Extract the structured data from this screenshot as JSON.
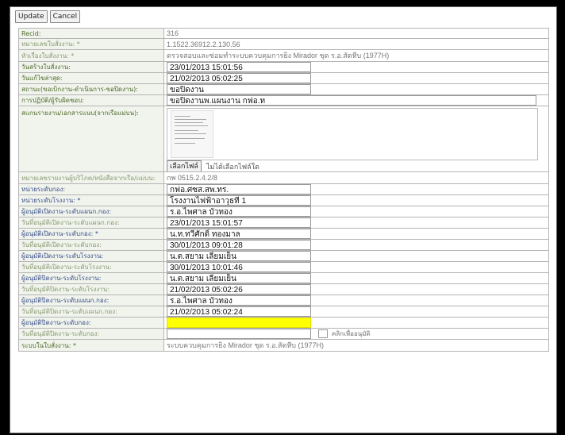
{
  "toolbar": {
    "update_label": "Update",
    "cancel_label": "Cancel"
  },
  "rows": {
    "recid": {
      "label": "Recid:",
      "value": "316"
    },
    "doc_no": {
      "label": "หมายเลขใบสั่งงาน: *",
      "value": "1.1522.36912.2.130.56"
    },
    "subject": {
      "label": "หัวเรื่องใบสั่งงาน: *",
      "value": "ตรวจสอบและซ่อมทำระบบควบคุมการยิง Mirador ชุด ร.อ.สัตหีบ (1977H)"
    },
    "created": {
      "label": "วันสร้างใบสั่งงาน:",
      "value": "23/01/2013 15:01:56"
    },
    "updated": {
      "label": "วันแก้ไขล่าสุด:",
      "value": "21/02/2013 05:02:25"
    },
    "status": {
      "label": "สถานะ(ขอเบิกงาน-ดำเนินการ-ขอปิดงาน):",
      "value": "ขอปิดงาน"
    },
    "result": {
      "label": "การปฏิบัติ/ผู้รับผิดชอบ:",
      "value": "ขอปิดงานพ.แผนงาน กฟอ.ท"
    },
    "attachment": {
      "label": "สแกนรายงาน/เอกสารแนบ(จากเรือแม่บน):",
      "button": "เลือกไฟล์",
      "no_file": "ไม่ได้เลือกไฟล์ใด"
    },
    "ref_no": {
      "label": "หมายเลขรายงานผู้บริโภค/หนังสือจากเรือ/แม่บน:",
      "value": "กพ 0515.2.4.2/8"
    },
    "unit": {
      "label": "หน่วยระดับกอง:",
      "value": "กฟอ.ศซส.สพ.ทร."
    },
    "plant": {
      "label": "หน่วยระดับโรงงาน: *",
      "value": "โรงงานไฟฟ้าอาวุธที่ 1"
    },
    "approver1": {
      "label": "ผู้อนุมัติเปิดงาน-ระดับแผนก.กอง:",
      "value": "ร.อ.ไพศาล บัวทอง"
    },
    "approve_date1": {
      "label": "วันที่อนุมัติเปิดงาน-ระดับแผนก.กอง:",
      "value": "23/01/2013 15:01:57"
    },
    "approver2": {
      "label": "ผู้อนุมัติเปิดงาน-ระดับกอง: *",
      "value": "น.ท.ทวีศักดิ์ ทองมาล"
    },
    "approve_date2": {
      "label": "วันที่อนุมัติเปิดงาน-ระดับกอง:",
      "value": "30/01/2013 09:01:28"
    },
    "approver3": {
      "label": "ผู้อนุมัติเปิดงาน-ระดับโรงงาน:",
      "value": "น.ต.สยาม เลี่ยมเย็น"
    },
    "approve_date3": {
      "label": "วันที่อนุมัติเปิดงาน-ระดับโรงงาน:",
      "value": "30/01/2013 10:01:46"
    },
    "closer1": {
      "label": "ผู้อนุมัติปิดงาน-ระดับโรงงาน:",
      "value": "น.ต.สยาม เลี่ยมเย็น"
    },
    "close_date1": {
      "label": "วันที่อนุมัติปิดงาน-ระดับโรงงาน:",
      "value": "21/02/2013 05:02:26"
    },
    "closer2": {
      "label": "ผู้อนุมัติปิดงาน-ระดับแผนก.กอง:",
      "value": "ร.อ.ไพศาล บัวทอง"
    },
    "close_date2": {
      "label": "วันที่อนุมัติปิดงาน-ระดับแผนก.กอง:",
      "value": "21/02/2013 05:02:24"
    },
    "closer3": {
      "label": "ผู้อนุมัติปิดงาน-ระดับกอง:",
      "value": ""
    },
    "close_date3": {
      "label": "วันที่อนุมัติปิดงาน-ระดับกอง:",
      "value": "",
      "checkbox_label": "คลิกเพื่ออนุมัติ"
    },
    "system": {
      "label": "ระบบในใบสั่งงาน: *",
      "value": "ระบบควบคุมการยิง Mirador ชุด ร.อ.สัตหีบ (1977H)"
    }
  },
  "colors": {
    "highlight": "#ffff00",
    "label_bg": "#f0f4ec"
  }
}
